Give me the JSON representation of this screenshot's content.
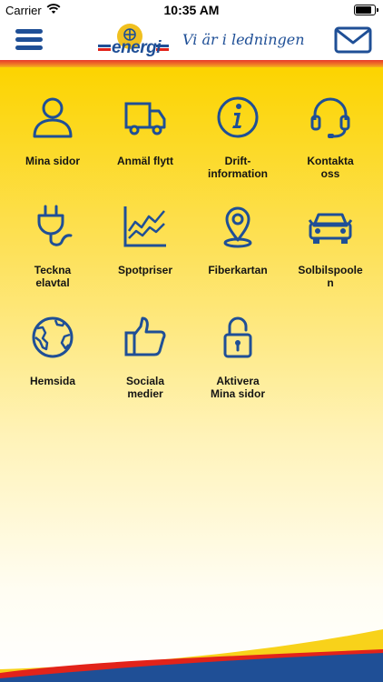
{
  "status_bar": {
    "carrier": "Carrier",
    "time": "10:35 AM"
  },
  "header": {
    "logo_text": "energi",
    "slogan": "Vi är i ledningen"
  },
  "colors": {
    "brand_blue": "#1f4f96",
    "yellow": "#fcd400",
    "red": "#e2231a"
  },
  "tiles": [
    {
      "label": "Mina sidor",
      "icon": "person-icon"
    },
    {
      "label": "Anmäl flytt",
      "icon": "truck-icon"
    },
    {
      "label": "Drift-\ninformation",
      "icon": "info-icon"
    },
    {
      "label": "Kontakta\noss",
      "icon": "headset-icon"
    },
    {
      "label": "Teckna\nelavtal",
      "icon": "power-plug-icon"
    },
    {
      "label": "Spotpriser",
      "icon": "line-chart-icon"
    },
    {
      "label": "Fiberkartan",
      "icon": "map-pin-icon"
    },
    {
      "label": "Solbilspoole\nn",
      "icon": "car-icon"
    },
    {
      "label": "Hemsida",
      "icon": "globe-icon"
    },
    {
      "label": "Sociala\nmedier",
      "icon": "thumbs-up-icon"
    },
    {
      "label": "Aktivera\nMina sidor",
      "icon": "unlock-icon"
    }
  ]
}
